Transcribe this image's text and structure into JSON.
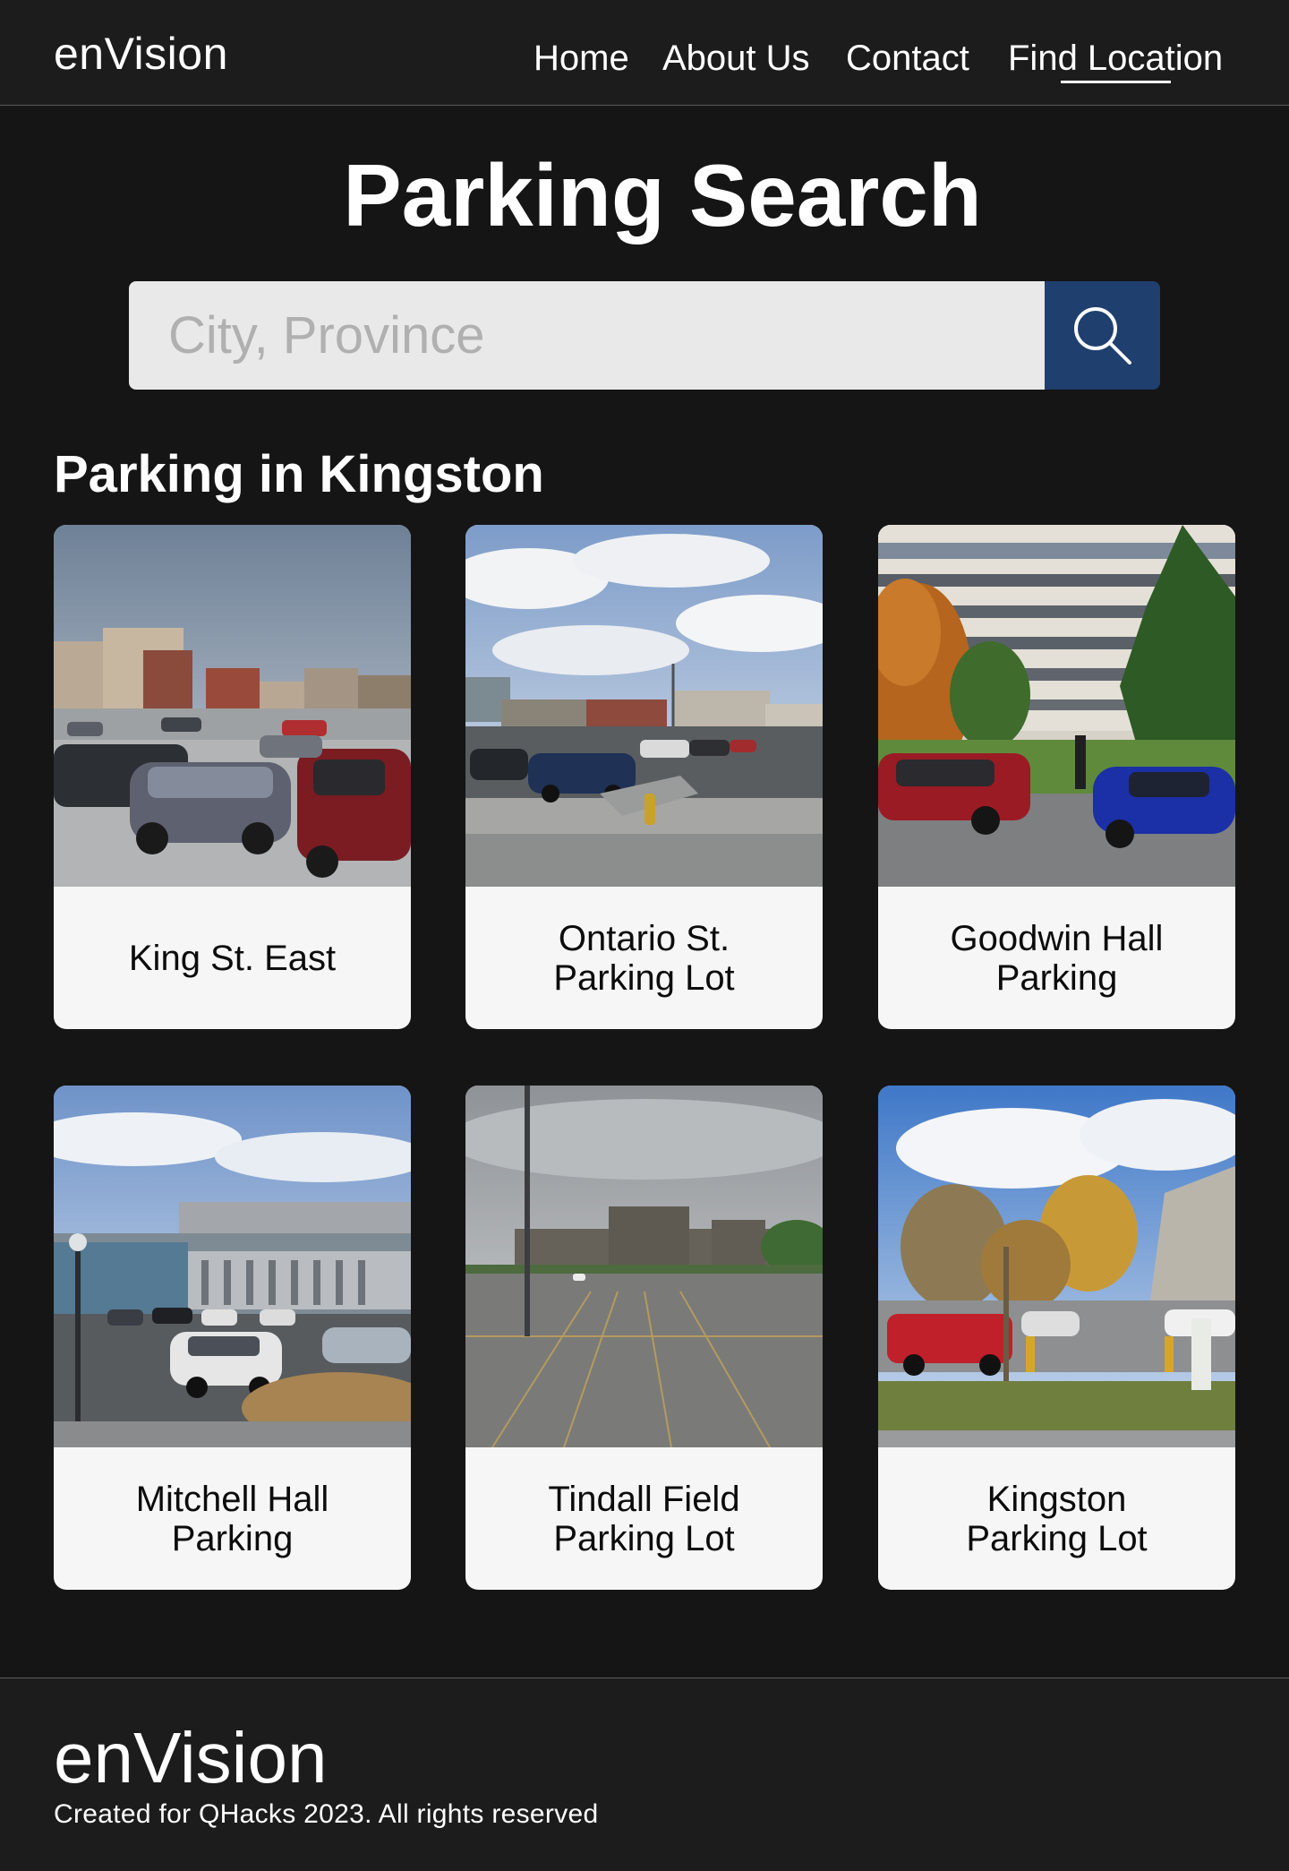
{
  "header": {
    "brand": "enVision",
    "nav": {
      "home": "Home",
      "about": "About Us",
      "contact": "Contact",
      "find_location": "Find Location"
    },
    "active_nav": "find_location"
  },
  "hero": {
    "title": "Parking Search",
    "search": {
      "placeholder": "City, Province",
      "value": "",
      "button_icon": "search-icon"
    }
  },
  "results": {
    "heading": "Parking in Kingston",
    "cards": [
      {
        "label": "King St. East",
        "photo": "parking-lot-photo"
      },
      {
        "label": "Ontario St. Parking Lot",
        "photo": "parking-lot-photo"
      },
      {
        "label": "Goodwin Hall Parking",
        "photo": "parking-lot-photo"
      },
      {
        "label": "Mitchell Hall Parking",
        "photo": "parking-lot-photo"
      },
      {
        "label": "Tindall Field Parking Lot",
        "photo": "parking-lot-photo"
      },
      {
        "label": "Kingston Parking Lot",
        "photo": "parking-lot-photo"
      }
    ]
  },
  "footer": {
    "brand": "enVision",
    "copyright": "Created for QHacks 2023. All rights reserved"
  },
  "colors": {
    "background": "#151515",
    "header_bg": "#1c1c1c",
    "search_button": "#1f3f6e",
    "search_input_bg": "#e9e9e9",
    "card_bg": "#f6f6f6"
  }
}
